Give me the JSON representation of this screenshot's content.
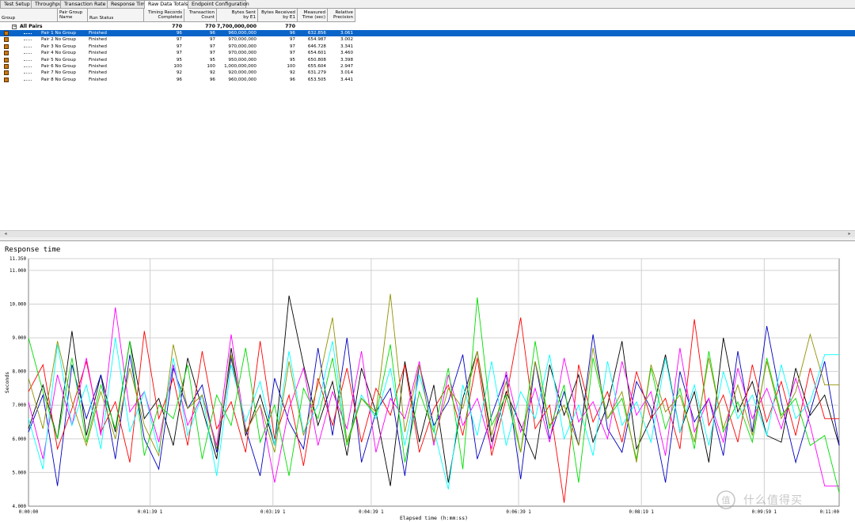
{
  "tabs": [
    {
      "label": "Test Setup",
      "active": false
    },
    {
      "label": "Throughput",
      "active": false
    },
    {
      "label": "Transaction Rate",
      "active": false
    },
    {
      "label": "Response Time",
      "active": false
    },
    {
      "label": "Raw Data Totals",
      "active": true
    },
    {
      "label": "Endpoint Configuration",
      "active": false
    }
  ],
  "table": {
    "headers": {
      "group": "Group",
      "pair_group_name": "Pair Group\nName",
      "run_status": "Run Status",
      "timing_records": "Timing Records\nCompleted",
      "transaction_count": "Transaction\nCount",
      "bytes_sent": "Bytes Sent\nby E1",
      "bytes_received": "Bytes Received\nby E1",
      "measured_time": "Measured\nTime (sec)",
      "relative_precision": "Relative\nPrecision"
    },
    "total_row": {
      "label": "All Pairs",
      "expander": "−",
      "timing_records": "770",
      "transaction_count": "770",
      "bytes_sent": "7,700,000,000",
      "bytes_received": "770"
    },
    "rows": [
      {
        "pair": "Pair 1 No Group",
        "status": "Finished",
        "timing": "96",
        "count": "96",
        "sent": "960,000,000",
        "received": "96",
        "time": "632.856",
        "precision": "3.061",
        "selected": true
      },
      {
        "pair": "Pair 2 No Group",
        "status": "Finished",
        "timing": "97",
        "count": "97",
        "sent": "970,000,000",
        "received": "97",
        "time": "654.987",
        "precision": "3.002",
        "selected": false
      },
      {
        "pair": "Pair 3 No Group",
        "status": "Finished",
        "timing": "97",
        "count": "97",
        "sent": "970,000,000",
        "received": "97",
        "time": "646.728",
        "precision": "3.341",
        "selected": false
      },
      {
        "pair": "Pair 4 No Group",
        "status": "Finished",
        "timing": "97",
        "count": "97",
        "sent": "970,000,000",
        "received": "97",
        "time": "654.601",
        "precision": "3.460",
        "selected": false
      },
      {
        "pair": "Pair 5 No Group",
        "status": "Finished",
        "timing": "95",
        "count": "95",
        "sent": "950,000,000",
        "received": "95",
        "time": "650.808",
        "precision": "3.398",
        "selected": false
      },
      {
        "pair": "Pair 6 No Group",
        "status": "Finished",
        "timing": "100",
        "count": "100",
        "sent": "1,000,000,000",
        "received": "100",
        "time": "655.604",
        "precision": "2.947",
        "selected": false
      },
      {
        "pair": "Pair 7 No Group",
        "status": "Finished",
        "timing": "92",
        "count": "92",
        "sent": "920,000,000",
        "received": "92",
        "time": "631.279",
        "precision": "3.014",
        "selected": false
      },
      {
        "pair": "Pair 8 No Group",
        "status": "Finished",
        "timing": "96",
        "count": "96",
        "sent": "960,000,000",
        "received": "96",
        "time": "653.505",
        "precision": "3.441",
        "selected": false
      }
    ]
  },
  "chart_data": {
    "type": "line",
    "title": "Response time",
    "xlabel": "Elapsed time (h:mm:ss)",
    "ylabel": "Seconds",
    "ylim": [
      4.0,
      11.35
    ],
    "xlim": [
      0,
      660
    ],
    "y_ticks": [
      {
        "value": 4.0,
        "label": "4.000"
      },
      {
        "value": 5.0,
        "label": "5.000"
      },
      {
        "value": 6.0,
        "label": "6.000"
      },
      {
        "value": 7.0,
        "label": "7.000"
      },
      {
        "value": 8.0,
        "label": "8.000"
      },
      {
        "value": 9.0,
        "label": "9.000"
      },
      {
        "value": 10.0,
        "label": "10.000"
      },
      {
        "value": 11.0,
        "label": "11.000"
      },
      {
        "value": 11.35,
        "label": "11.350"
      }
    ],
    "x_ticks": [
      {
        "value": 0,
        "label": "0:00:00"
      },
      {
        "value": 99,
        "label": "0:01:39 1"
      },
      {
        "value": 199,
        "label": "0:03:19 1"
      },
      {
        "value": 279,
        "label": "0:04:39 1"
      },
      {
        "value": 399,
        "label": "0:06:39 1"
      },
      {
        "value": 499,
        "label": "0:08:19 1"
      },
      {
        "value": 599,
        "label": "0:09:59 1"
      },
      {
        "value": 660,
        "label": "0:11:00"
      }
    ],
    "grid": true,
    "series": [
      {
        "color": "#000000",
        "values": [
          6.3,
          7.6,
          6.0,
          9.2,
          6.1,
          7.9,
          6.2,
          8.9,
          6.6,
          7.2,
          5.8,
          8.4,
          6.9,
          5.4,
          8.7,
          6.1,
          7.3,
          5.8,
          10.25,
          8.2,
          6.4,
          7.7,
          5.5,
          8.1,
          6.8,
          4.6,
          8.3,
          5.9,
          7.6,
          4.7,
          7.2,
          8.6,
          5.9,
          7.4,
          6.4,
          5.4,
          8.2,
          6.7,
          7.9,
          5.9,
          7.0,
          8.9,
          5.7,
          6.6,
          8.5,
          6.2,
          7.4,
          5.3,
          9.0,
          6.8,
          7.7,
          6.1,
          5.9,
          8.1,
          6.7,
          7.3,
          5.8
        ]
      },
      {
        "color": "#0000c0",
        "values": [
          6.2,
          7.3,
          4.6,
          8.2,
          6.6,
          7.9,
          5.4,
          8.5,
          6.0,
          5.1,
          8.1,
          6.9,
          7.6,
          5.6,
          8.4,
          6.3,
          4.9,
          7.8,
          6.5,
          5.7,
          8.7,
          6.1,
          9.0,
          5.3,
          6.8,
          7.5,
          4.9,
          8.2,
          6.4,
          7.1,
          8.5,
          5.4,
          6.7,
          7.9,
          4.8,
          8.3,
          6.0,
          7.4,
          5.8,
          9.1,
          6.3,
          5.6,
          7.7,
          6.9,
          4.7,
          8.0,
          6.5,
          7.2,
          5.5,
          8.6,
          6.2,
          9.35,
          7.1,
          5.3,
          6.8,
          8.3,
          5.8
        ]
      },
      {
        "color": "#ff0000",
        "values": [
          7.4,
          8.2,
          5.7,
          6.9,
          8.3,
          6.2,
          7.1,
          5.3,
          9.2,
          6.6,
          7.8,
          5.8,
          8.6,
          6.3,
          7.1,
          5.6,
          8.9,
          6.0,
          7.3,
          5.2,
          7.8,
          6.4,
          8.1,
          5.9,
          7.5,
          6.7,
          8.2,
          5.6,
          6.9,
          7.6,
          6.1,
          8.4,
          5.5,
          7.2,
          9.6,
          6.3,
          7.0,
          4.1,
          8.2,
          6.5,
          7.4,
          5.9,
          8.0,
          6.6,
          7.2,
          5.7,
          9.55,
          6.4,
          7.3,
          5.9,
          8.2,
          6.5,
          7.7,
          6.1,
          8.1,
          6.6,
          6.6
        ]
      },
      {
        "color": "#ff00ff",
        "values": [
          7.1,
          5.4,
          7.9,
          6.4,
          8.4,
          6.1,
          9.9,
          6.8,
          7.4,
          5.9,
          8.2,
          6.4,
          7.3,
          5.8,
          9.1,
          6.2,
          7.0,
          4.7,
          6.9,
          8.1,
          5.8,
          7.4,
          6.3,
          8.6,
          5.6,
          7.2,
          6.6,
          8.3,
          5.8,
          7.9,
          6.4,
          7.2,
          5.7,
          8.0,
          6.2,
          7.5,
          5.9,
          8.4,
          6.5,
          7.1,
          6.0,
          8.3,
          6.7,
          7.4,
          5.5,
          8.7,
          6.2,
          7.2,
          5.9,
          8.1,
          6.6,
          7.5,
          6.3,
          7.8,
          6.4,
          4.6,
          4.6
        ]
      },
      {
        "color": "#00ffff",
        "values": [
          6.6,
          5.1,
          8.8,
          6.4,
          7.6,
          5.7,
          9.0,
          6.2,
          7.4,
          5.6,
          8.4,
          6.1,
          7.3,
          4.9,
          8.2,
          6.5,
          7.7,
          5.8,
          8.6,
          6.2,
          7.0,
          8.9,
          5.9,
          7.3,
          6.6,
          8.1,
          5.8,
          7.9,
          6.3,
          4.5,
          7.6,
          6.1,
          8.3,
          5.8,
          7.4,
          6.6,
          8.5,
          6.0,
          7.0,
          5.5,
          8.3,
          6.4,
          7.1,
          5.9,
          8.4,
          6.2,
          7.6,
          5.8,
          8.0,
          6.6,
          7.3,
          6.1,
          8.2,
          6.6,
          7.1,
          8.5,
          8.5
        ]
      },
      {
        "color": "#00dd00",
        "values": [
          9.0,
          7.4,
          6.0,
          8.4,
          5.9,
          7.6,
          6.3,
          8.9,
          5.5,
          7.0,
          6.6,
          8.2,
          5.4,
          7.3,
          6.4,
          8.7,
          5.9,
          7.0,
          4.9,
          7.5,
          6.6,
          8.4,
          5.8,
          7.2,
          6.7,
          8.8,
          5.3,
          7.4,
          6.2,
          8.1,
          5.1,
          10.2,
          6.4,
          7.3,
          5.6,
          8.9,
          6.3,
          7.6,
          4.7,
          8.4,
          6.6,
          7.2,
          5.4,
          8.1,
          6.3,
          7.5,
          5.7,
          8.6,
          6.2,
          7.1,
          5.9,
          8.4,
          6.7,
          7.2,
          5.8,
          6.1,
          4.4
        ]
      },
      {
        "color": "#909000",
        "values": [
          7.8,
          6.3,
          8.9,
          7.1,
          5.8,
          7.4,
          6.0,
          8.1,
          6.4,
          5.5,
          8.8,
          6.9,
          7.3,
          5.7,
          8.5,
          6.2,
          7.0,
          5.6,
          8.3,
          6.1,
          7.6,
          9.6,
          5.9,
          7.2,
          6.8,
          10.3,
          6.2,
          8.2,
          5.9,
          7.5,
          6.9,
          8.6,
          6.1,
          7.7,
          5.6,
          8.3,
          6.4,
          7.0,
          5.8,
          8.7,
          6.6,
          7.4,
          5.3,
          8.2,
          6.8,
          7.3,
          5.9,
          8.4,
          6.3,
          7.6,
          6.1,
          8.3,
          6.6,
          7.4,
          9.1,
          7.6,
          7.6
        ]
      }
    ]
  },
  "watermark_text": "值 什么值得买"
}
